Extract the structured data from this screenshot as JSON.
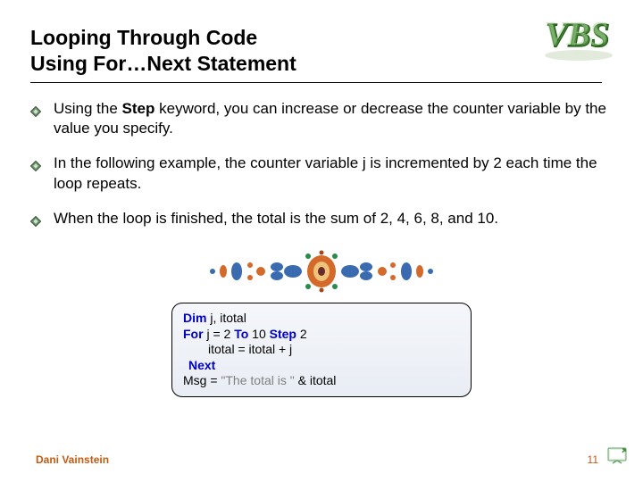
{
  "title": {
    "line1": "Looping Through Code",
    "line2": "Using For…Next Statement"
  },
  "logo_text": "VBS",
  "bullets": [
    {
      "pre": "Using the ",
      "bold": "Step",
      "post": " keyword, you can increase or decrease the counter variable by the value you specify."
    },
    {
      "pre": "In the following example, the counter variable j is incremented by 2 each time the loop repeats.",
      "bold": "",
      "post": ""
    },
    {
      "pre": "When the loop is finished, the total is the sum of 2, 4, 6, 8, and 10.",
      "bold": "",
      "post": ""
    }
  ],
  "code": {
    "kw_dim": "Dim",
    "l1_rest": " j, itotal",
    "kw_for": "For",
    "l2_mid1": " j = 2 ",
    "kw_to": "To",
    "l2_mid2": " 10 ",
    "kw_step": "Step",
    "l2_end": " 2",
    "l3": "itotal = itotal + j",
    "kw_next": "Next",
    "l5_pre": "Msg = ",
    "l5_str": "\"The total is \"",
    "l5_post": " & itotal"
  },
  "footer": {
    "author": "Dani Vainstein",
    "page": "11"
  }
}
